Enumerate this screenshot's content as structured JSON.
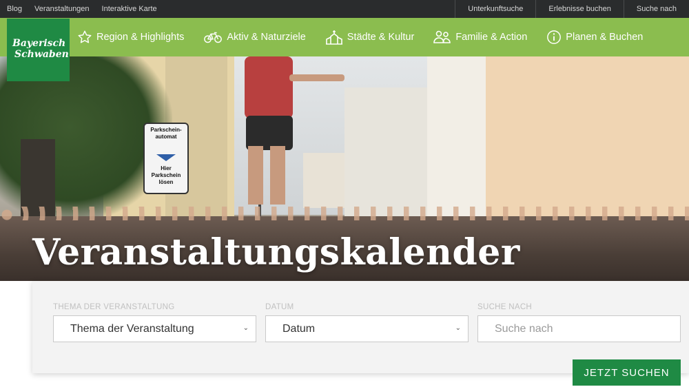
{
  "topbar": {
    "left_links": [
      "Blog",
      "Veranstaltungen",
      "Interaktive Karte"
    ],
    "right_links": [
      "Unterkunftsuche",
      "Erlebnisse buchen",
      "Suche nach"
    ]
  },
  "logo": {
    "line1": "Bayerisch",
    "line2": "Schwaben",
    "color": "#1f8a44"
  },
  "nav": {
    "background": "#8bbd4f",
    "items": [
      {
        "label": "Region & Highlights",
        "icon": "star-icon"
      },
      {
        "label": "Aktiv & Naturziele",
        "icon": "bicycle-icon"
      },
      {
        "label": "Städte & Kultur",
        "icon": "church-icon"
      },
      {
        "label": "Familie & Action",
        "icon": "family-icon"
      },
      {
        "label": "Planen & Buchen",
        "icon": "info-icon"
      }
    ]
  },
  "hero": {
    "title": "Veranstaltungskalender",
    "sign_text": [
      "Parkschein-",
      "automat",
      "Hier",
      "Parkschein",
      "lösen"
    ]
  },
  "search": {
    "fields": [
      {
        "label": "THEMA DER VERANSTALTUNG",
        "value": "Thema der Veranstaltung",
        "type": "select"
      },
      {
        "label": "DATUM",
        "value": "Datum",
        "type": "select"
      },
      {
        "label": "SUCHE NACH",
        "placeholder": "Suche nach",
        "type": "input"
      }
    ],
    "button_label": "JETZT SUCHEN",
    "button_color": "#1f8a44"
  }
}
